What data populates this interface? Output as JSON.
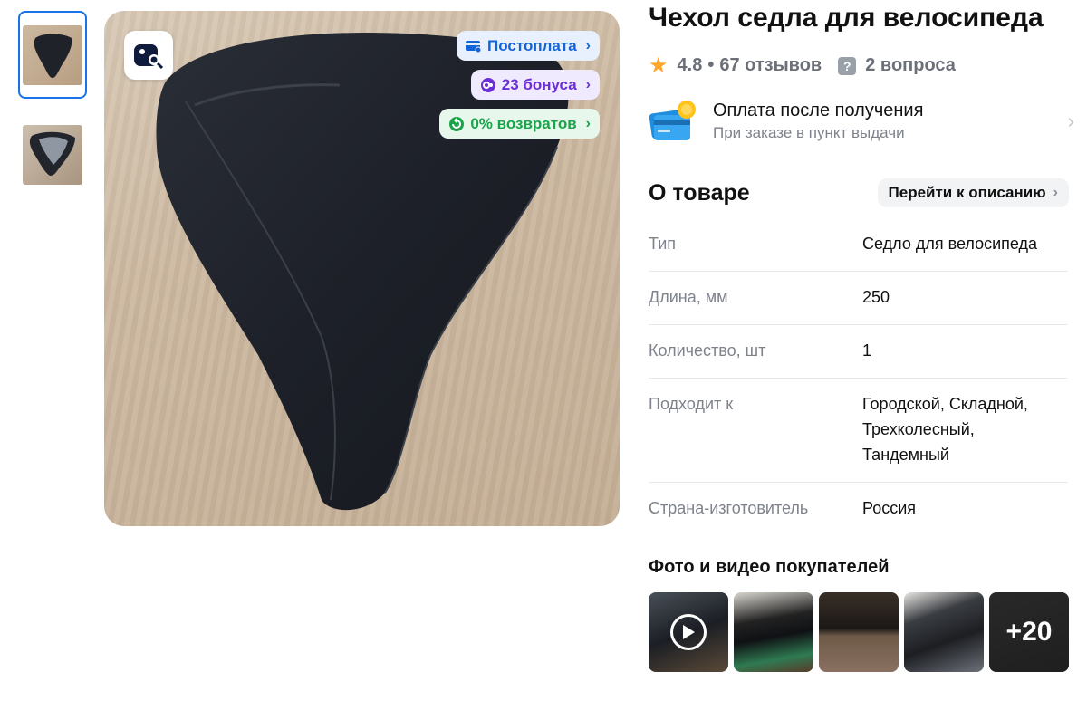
{
  "product": {
    "title": "Чехол седла для велосипеда",
    "rating": "4.8",
    "rating_sep": "•",
    "reviews": "67 отзывов",
    "questions": "2 вопроса"
  },
  "badges": {
    "postpay": "Постоплата",
    "bonus": "23 бонуса",
    "returns": "0% возвратов"
  },
  "payment": {
    "title": "Оплата после получения",
    "subtitle": "При заказе в пункт выдачи"
  },
  "about": {
    "heading": "О товаре",
    "goto_label": "Перейти к описанию",
    "specs": [
      {
        "key": "Тип",
        "value": "Седло для велосипеда"
      },
      {
        "key": "Длина, мм",
        "value": "250"
      },
      {
        "key": "Количество, шт",
        "value": "1"
      },
      {
        "key": "Подходит к",
        "value": "Городской, Складной, Трехколесный, Тандемный"
      },
      {
        "key": "Страна-изготовитель",
        "value": "Россия"
      }
    ]
  },
  "buyers": {
    "title": "Фото и видео покупателей",
    "more_label": "+20"
  },
  "colors": {
    "accent_blue": "#1a73e8",
    "star": "#ffa62b"
  },
  "icons": [
    "star-icon",
    "question-icon",
    "card-icon",
    "photo-search-icon",
    "play-icon",
    "chevron-right-icon"
  ]
}
